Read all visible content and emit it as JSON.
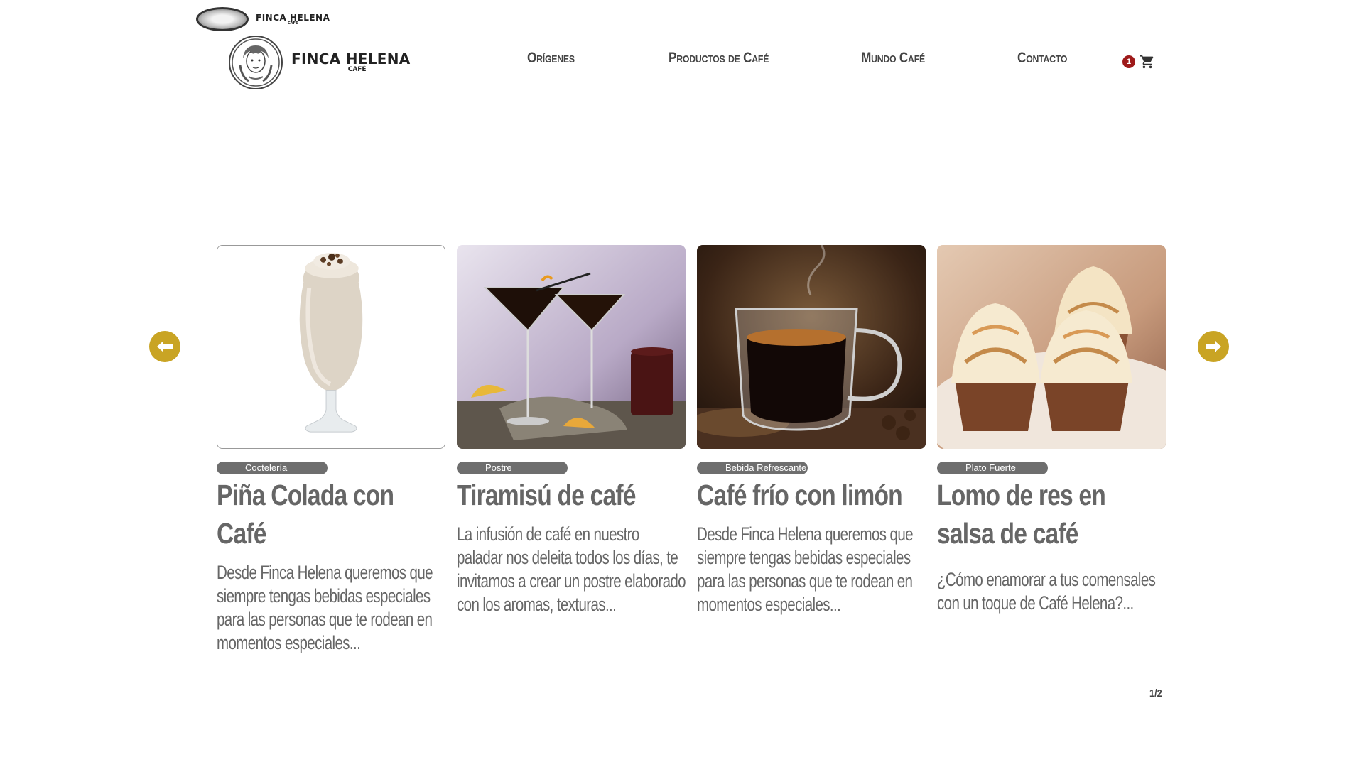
{
  "header": {
    "mini_logo_name": "FINCA HELENA",
    "mini_logo_sub": "CAFÉ",
    "logo_name": "FINCA HELENA",
    "logo_sub": "CAFÉ",
    "nav": [
      {
        "label": "Orígenes"
      },
      {
        "label": "Productos de Café"
      },
      {
        "label": "Mundo Café"
      },
      {
        "label": "Contacto"
      }
    ],
    "cart_count": "1",
    "cart_icon": "shopping-cart-icon"
  },
  "carousel": {
    "prev_icon": "arrow-left-icon",
    "next_icon": "arrow-right-icon",
    "accent_color": "#c9a424",
    "cards": [
      {
        "category": "Coctelería",
        "title": "Piña Colada con Café",
        "description": "Desde Finca Helena queremos que siempre tengas bebidas especiales para las personas que te rodean en momentos  especiales..."
      },
      {
        "category": "Postre",
        "title": "Tiramisú de café",
        "description": "La infusión de café en nuestro paladar nos deleita todos los días, te invitamos a crear un postre elaborado con los aromas, texturas..."
      },
      {
        "category": "Bebida Refrescante",
        "title": "Café frío con limón",
        "description": "Desde Finca Helena queremos que siempre tengas bebidas especiales para las personas que te rodean en momentos  especiales..."
      },
      {
        "category": "Plato Fuerte",
        "title": "Lomo de res en salsa de café",
        "description": "¿Cómo enamorar a tus comensales con un toque de Café Helena?..."
      }
    ],
    "pager": "1/2"
  },
  "colors": {
    "badge": "#9e1a1a",
    "category_pill": "#6e6e6e",
    "text": "#666666"
  }
}
